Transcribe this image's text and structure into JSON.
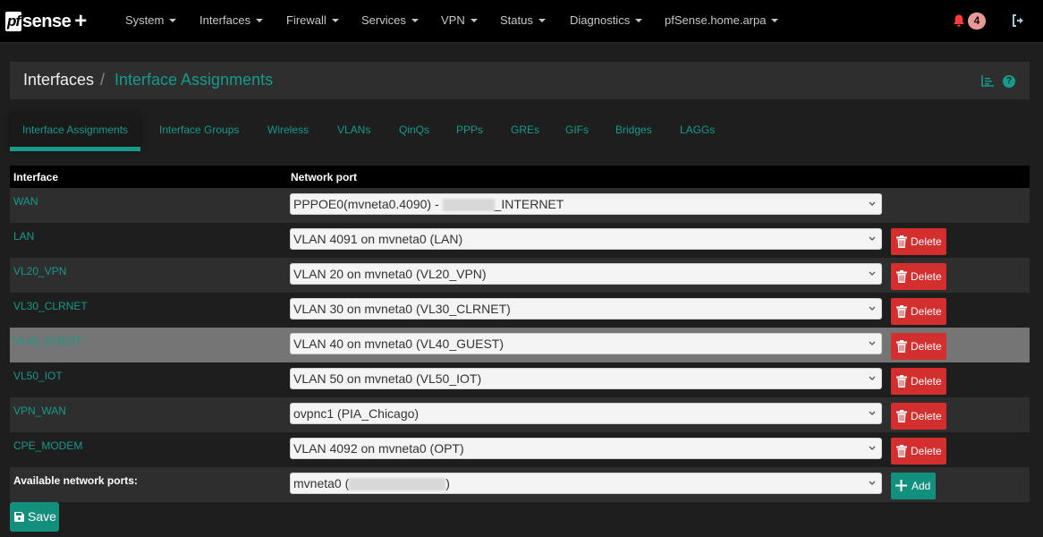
{
  "brand": {
    "logo_pf": "pf",
    "logo_sense": "sense",
    "logo_plus": "+"
  },
  "nav": {
    "items": [
      {
        "label": "System"
      },
      {
        "label": "Interfaces"
      },
      {
        "label": "Firewall"
      },
      {
        "label": "Services"
      },
      {
        "label": "VPN"
      },
      {
        "label": "Status"
      },
      {
        "label": "Diagnostics"
      },
      {
        "label": "pfSense.home.arpa"
      }
    ],
    "notifications_count": "4",
    "icons": {
      "notifications": "bell-icon",
      "logout": "sign-out-icon"
    }
  },
  "breadcrumb": {
    "root": "Interfaces",
    "separator": "/",
    "current": "Interface Assignments",
    "icons": [
      "chart-bars-icon",
      "help-icon"
    ],
    "help_glyph": "?"
  },
  "tabs": [
    {
      "label": "Interface Assignments",
      "active": true
    },
    {
      "label": "Interface Groups",
      "active": false
    },
    {
      "label": "Wireless",
      "active": false
    },
    {
      "label": "VLANs",
      "active": false
    },
    {
      "label": "QinQs",
      "active": false
    },
    {
      "label": "PPPs",
      "active": false
    },
    {
      "label": "GREs",
      "active": false
    },
    {
      "label": "GIFs",
      "active": false
    },
    {
      "label": "Bridges",
      "active": false
    },
    {
      "label": "LAGGs",
      "active": false
    }
  ],
  "table": {
    "headers": {
      "interface": "Interface",
      "network_port": "Network port"
    },
    "rows": [
      {
        "interface": "WAN",
        "port_prefix": "PPPOE0(mvneta0.4090) - ",
        "port_suffix": "_INTERNET",
        "port_redacted": true,
        "deletable": false
      },
      {
        "interface": "LAN",
        "port": "VLAN 4091 on mvneta0 (LAN)",
        "deletable": true
      },
      {
        "interface": "VL20_VPN",
        "port": "VLAN 20 on mvneta0 (VL20_VPN)",
        "deletable": true
      },
      {
        "interface": "VL30_CLRNET",
        "port": "VLAN 30 on mvneta0 (VL30_CLRNET)",
        "deletable": true
      },
      {
        "interface": "VL40_GUEST",
        "port": "VLAN 40 on mvneta0 (VL40_GUEST)",
        "deletable": true,
        "highlighted": true
      },
      {
        "interface": "VL50_IOT",
        "port": "VLAN 50 on mvneta0 (VL50_IOT)",
        "deletable": true
      },
      {
        "interface": "VPN_WAN",
        "port": "ovpnc1 (PIA_Chicago)",
        "deletable": true
      },
      {
        "interface": "CPE_MODEM",
        "port": "VLAN 4092 on mvneta0 (OPT)",
        "deletable": true
      }
    ],
    "delete_label": "Delete",
    "available": {
      "label": "Available network ports:",
      "port_prefix": "mvneta0 (",
      "port_suffix": ")",
      "port_redacted": true,
      "add_label": "Add"
    }
  },
  "actions": {
    "save_label": "Save"
  },
  "colors": {
    "accent": "#159b8a",
    "danger": "#d32f2f",
    "navbar": "#000000",
    "background": "#1e1e1e"
  }
}
